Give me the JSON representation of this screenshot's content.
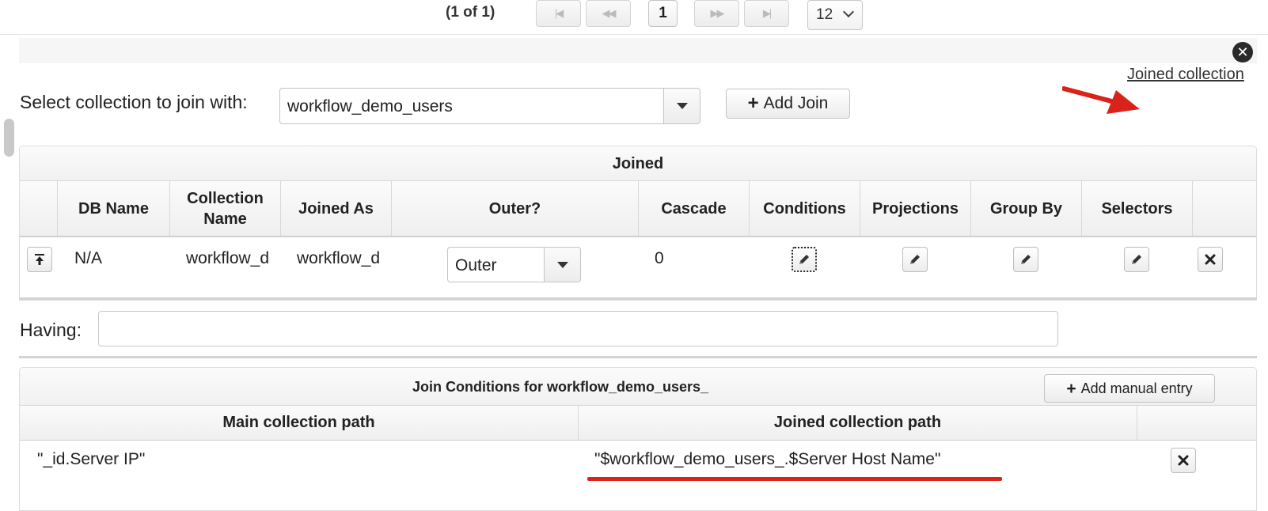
{
  "paginator": {
    "label": "(1 of 1)",
    "first_icon": "first-page-icon",
    "first_glyph": "|◀",
    "prev_icon": "prev-page-icon",
    "prev_glyph": "◀◀",
    "current_page": "1",
    "next_icon": "next-page-icon",
    "next_glyph": "▶▶",
    "last_icon": "last-page-icon",
    "last_glyph": "▶|",
    "rows_per_page": "12"
  },
  "panel": {
    "close_icon": "close-circle-icon",
    "close_glyph": "✕",
    "annotation_arrow_color": "#d9231a",
    "joined_collection_link": "Joined collection"
  },
  "join_selector": {
    "label": "Select collection to join with:",
    "selected": "workflow_demo_users",
    "add_button": "Add Join",
    "add_glyph": "+"
  },
  "joined_table": {
    "caption": "Joined",
    "headers": [
      "",
      "DB Name",
      "Collection Name",
      "Joined As",
      "Outer?",
      "Cascade",
      "Conditions",
      "Projections",
      "Group By",
      "Selectors",
      ""
    ],
    "rows": [
      {
        "move_icon": "move-to-top-icon",
        "db_name": "N/A",
        "collection_name": "workflow_d",
        "joined_as": "workflow_d",
        "outer": "Outer",
        "cascade": "0",
        "conditions_icon": "pencil-icon",
        "projections_icon": "pencil-icon",
        "group_by_icon": "pencil-icon",
        "selectors_icon": "pencil-icon",
        "delete_icon": "delete-icon"
      }
    ]
  },
  "having": {
    "label": "Having:",
    "value": ""
  },
  "join_conditions": {
    "title": "Join Conditions for workflow_demo_users_",
    "add_button": "Add manual entry",
    "add_glyph": "+",
    "headers": [
      "Main collection path",
      "Joined collection path",
      ""
    ],
    "rows": [
      {
        "main_path": "\"_id.Server IP\"",
        "joined_path": "\"$workflow_demo_users_.$Server Host Name\"",
        "delete_icon": "delete-icon"
      }
    ],
    "highlight_color": "#d9231a"
  }
}
